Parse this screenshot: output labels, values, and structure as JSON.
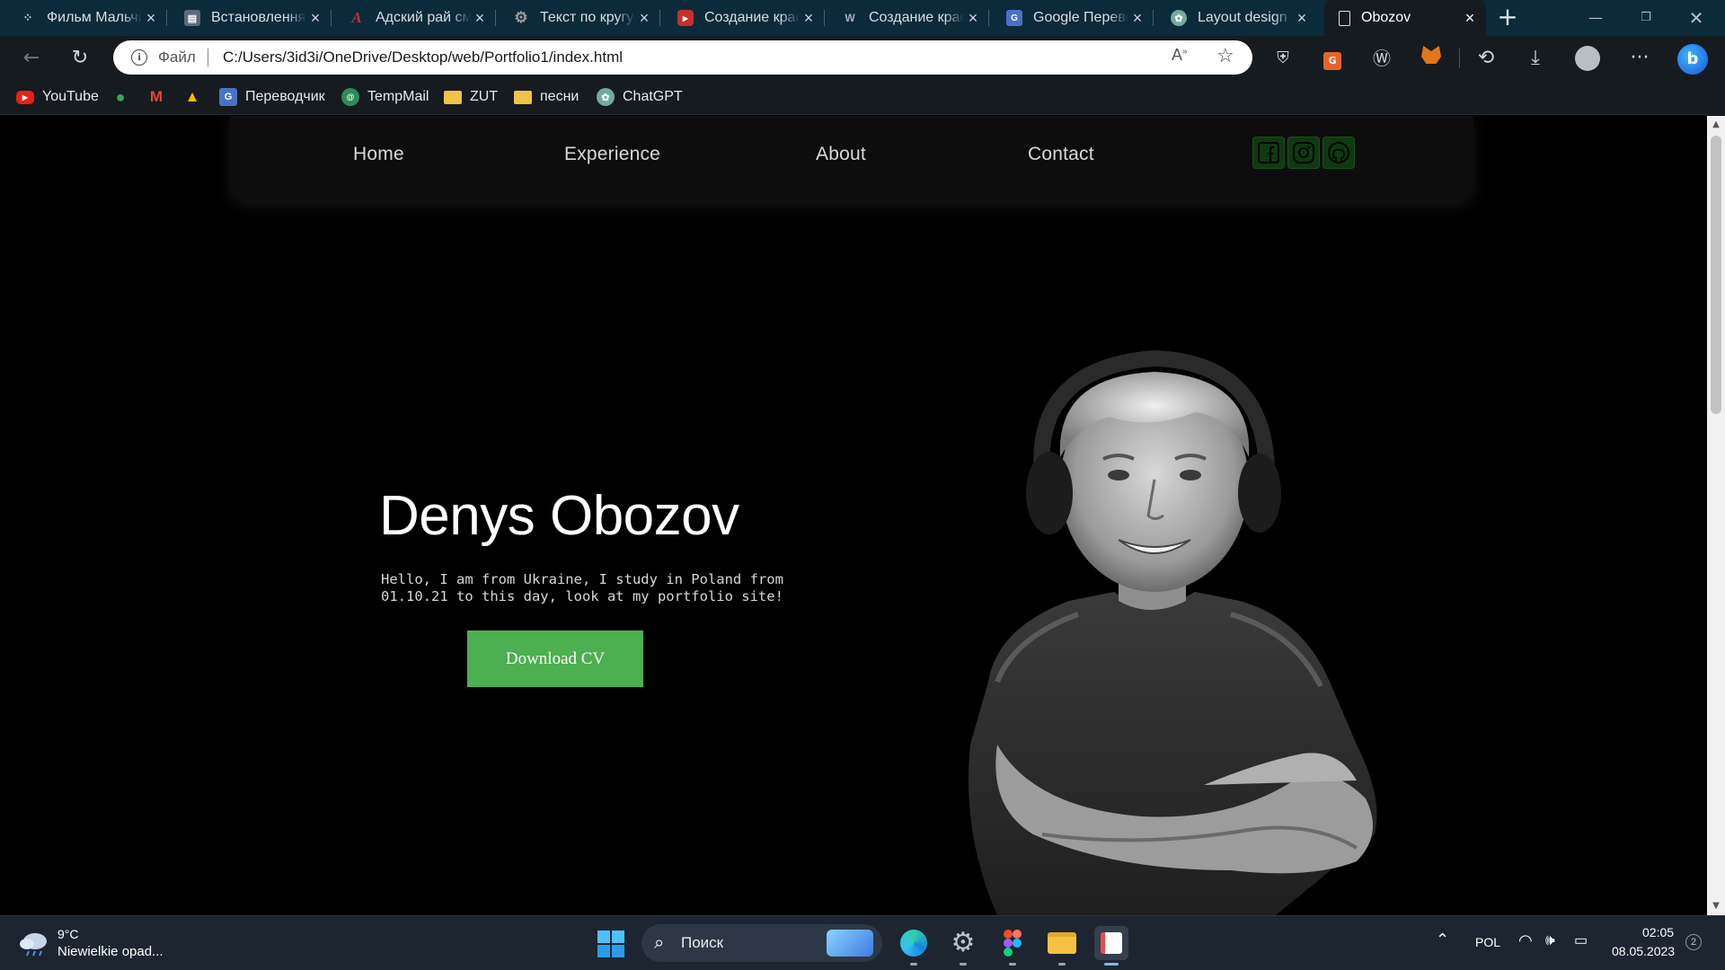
{
  "browser": {
    "tabs": [
      {
        "label": "Фильм Мальчик",
        "favicon": "dots-icon",
        "color": "#3b4b55"
      },
      {
        "label": "Встановлення",
        "favicon": "book-icon",
        "color": "#5a6a80"
      },
      {
        "label": "Адский рай см",
        "favicon": "letter-a-icon",
        "color": "#7a2b2b"
      },
      {
        "label": "Текст по кругу",
        "favicon": "gear-icon",
        "color": "#6b6b6b"
      },
      {
        "label": "Создание крас",
        "favicon": "youtube-icon",
        "color": "#c4302b"
      },
      {
        "label": "Создание крас",
        "favicon": "w-icon",
        "color": "#3b4b55"
      },
      {
        "label": "Google Переводч",
        "favicon": "translate-icon",
        "color": "#4a72c4"
      },
      {
        "label": "Layout design",
        "favicon": "chatgpt-icon",
        "color": "#74aa9c"
      },
      {
        "label": "Obozov",
        "favicon": "page-icon",
        "color": "#161b1f"
      }
    ],
    "address": {
      "protocol_label": "Файл",
      "url": "C:/Users/3id3i/OneDrive/Desktop/web/Portfolio1/index.html",
      "read_aloud": "Ȃ"
    },
    "bookmarks": [
      {
        "label": "YouTube",
        "icon": "youtube-icon",
        "color": "#e62117"
      },
      {
        "label": "",
        "icon": "maps-pin-icon",
        "color": "#34a853"
      },
      {
        "label": "",
        "icon": "gmail-icon",
        "color": "#ea4335"
      },
      {
        "label": "",
        "icon": "drive-icon",
        "color": "#fbbc04"
      },
      {
        "label": "Переводчик",
        "icon": "translate-icon",
        "color": "#4a72c4"
      },
      {
        "label": "TempMail",
        "icon": "tempmail-icon",
        "color": "#2e8b57"
      },
      {
        "label": "ZUT",
        "icon": "folder-icon",
        "color": "#f0c24b"
      },
      {
        "label": "песни",
        "icon": "folder-icon",
        "color": "#f0c24b"
      },
      {
        "label": "ChatGPT",
        "icon": "chatgpt-icon",
        "color": "#74aa9c"
      }
    ]
  },
  "site": {
    "nav": {
      "home": "Home",
      "experience": "Experience",
      "about": "About",
      "contact": "Contact"
    },
    "socials": [
      "facebook-icon",
      "instagram-icon",
      "github-icon"
    ],
    "hero": {
      "name": "Denys Obozov",
      "intro_line1": "Hello, I am from Ukraine, I study in Poland from",
      "intro_line2": "01.10.21 to this day, look at my portfolio site!",
      "cv_button": "Download CV"
    },
    "accent_color": "#4caf50"
  },
  "taskbar": {
    "weather_temp": "9°C",
    "weather_desc": "Niewielkie opad...",
    "search_label": "Поиск",
    "language": "POL",
    "time": "02:05",
    "date": "08.05.2023",
    "notification_count": "2"
  }
}
